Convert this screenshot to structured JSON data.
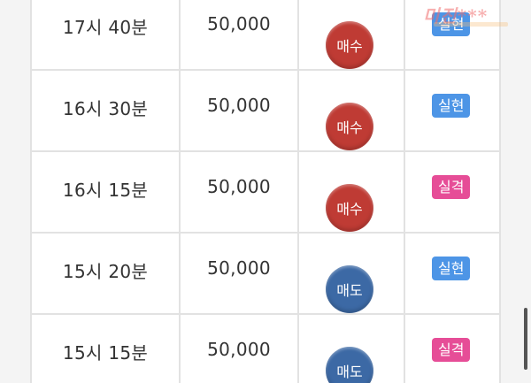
{
  "watermark": "미진***",
  "rows": [
    {
      "time": "17시 40분",
      "amount": "50,000",
      "trade": "매수",
      "result": "실현"
    },
    {
      "time": "16시 30분",
      "amount": "50,000",
      "trade": "매수",
      "result": "실현"
    },
    {
      "time": "16시 15분",
      "amount": "50,000",
      "trade": "매수",
      "result": "실격"
    },
    {
      "time": "15시 20분",
      "amount": "50,000",
      "trade": "매도",
      "result": "실현"
    },
    {
      "time": "15시 15분",
      "amount": "50,000",
      "trade": "매도",
      "result": "실격"
    }
  ],
  "colors": {
    "buy": "#bf3b34",
    "sell": "#3c69a5",
    "success": "#4d95e6",
    "fail": "#e64d97"
  }
}
